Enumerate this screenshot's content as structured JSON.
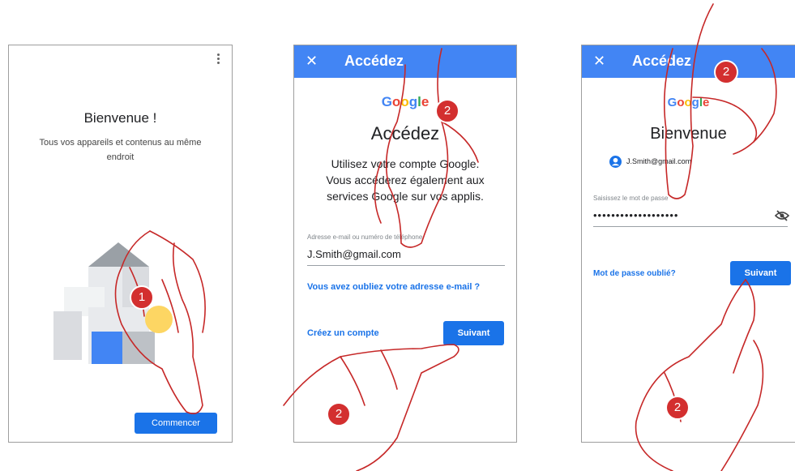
{
  "screen1": {
    "menu_icon": "more-vertical-icon",
    "title": "Bienvenue !",
    "subtitle_line1": "Tous vos appareils et contenus au même",
    "subtitle_line2": "endroit",
    "start_button": "Commencer",
    "step_badge": "1"
  },
  "screen2": {
    "close": "✕",
    "appbar_title": "Accédez",
    "logo": [
      "G",
      "o",
      "o",
      "g",
      "l",
      "e"
    ],
    "logo_colors": [
      "#4285f4",
      "#ea4335",
      "#fbbc05",
      "#4285f4",
      "#34a853",
      "#ea4335"
    ],
    "heading": "Accédez",
    "body_line1": "Utilisez votre compte Google.",
    "body_line2": "Vous accéderez également aux",
    "body_line3": "services Google sur vos applis.",
    "input_label": "Adresse e-mail ou numéro de téléphone",
    "input_value": "J.Smith@gmail.com",
    "forgot_email": "Vous avez oubliez votre adresse e-mail ?",
    "create_account": "Créez un compte",
    "next_button": "Suivant",
    "step_badge_top": "2",
    "step_badge_bottom": "2"
  },
  "screen3": {
    "close": "✕",
    "appbar_title": "Accédez",
    "heading": "Bienvenue",
    "account_email": "J.Smith@gmail.com",
    "password_label": "Saisissez le mot de passe",
    "password_value": "•••••••••••••••••••",
    "eye_icon": "eye-off-icon",
    "forgot_password": "Mot de passe oublié?",
    "next_button": "Suivant",
    "step_badge_top": "2",
    "step_badge_bottom": "2"
  },
  "colors": {
    "accent": "#1a73e8",
    "appbar": "#4285f4",
    "badge": "#d32f2f",
    "hand_outline": "#c62828"
  }
}
